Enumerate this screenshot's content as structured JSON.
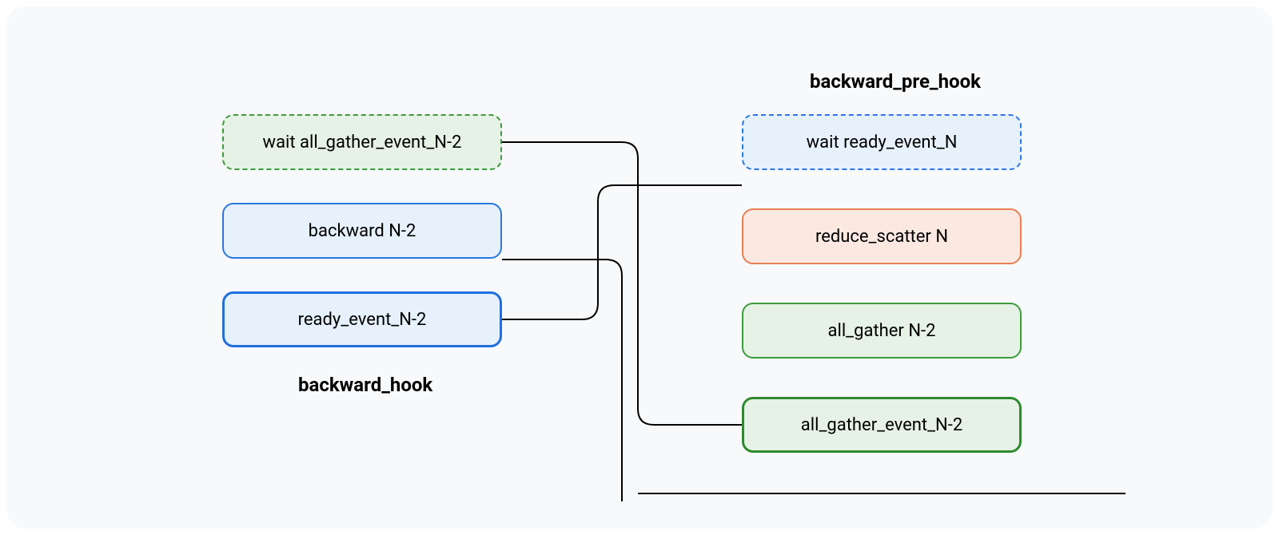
{
  "labels": {
    "backward_hook": "backward_hook",
    "backward_pre_hook": "backward_pre_hook"
  },
  "left_column": {
    "wait_all_gather": "wait all_gather_event_N-2",
    "backward": "backward N-2",
    "ready_event": "ready_event_N-2"
  },
  "right_column": {
    "wait_ready": "wait ready_event_N",
    "reduce_scatter": "reduce_scatter N",
    "all_gather": "all_gather N-2",
    "all_gather_event": "all_gather_event_N-2"
  }
}
